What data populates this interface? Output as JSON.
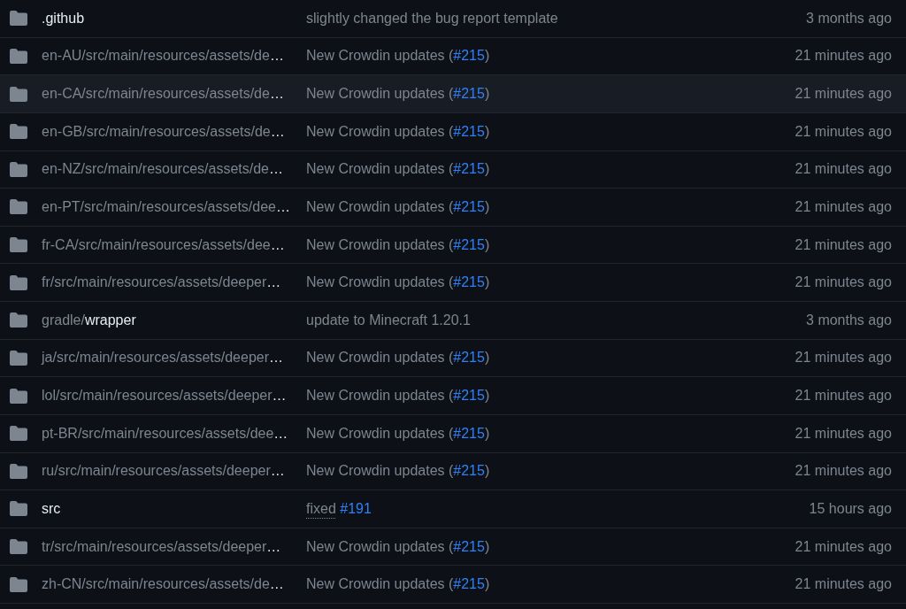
{
  "files": [
    {
      "name": {
        "bright_part": ".github"
      },
      "message": [
        {
          "kind": "text",
          "text": "slightly changed the bug report template"
        }
      ],
      "updated": "3 months ago",
      "highlighted": false
    },
    {
      "name": {
        "dim_part": "en-AU/src/main/resources/assets/de",
        "bright_part": "…"
      },
      "message": [
        {
          "kind": "text",
          "text": "New Crowdin updates ("
        },
        {
          "kind": "issue",
          "text": "#215"
        },
        {
          "kind": "text",
          "text": ")"
        }
      ],
      "updated": "21 minutes ago",
      "highlighted": false
    },
    {
      "name": {
        "dim_part": "en-CA/src/main/resources/assets/de",
        "bright_part": "…"
      },
      "message": [
        {
          "kind": "text",
          "text": "New Crowdin updates ("
        },
        {
          "kind": "issue",
          "text": "#215"
        },
        {
          "kind": "text",
          "text": ")"
        }
      ],
      "updated": "21 minutes ago",
      "highlighted": true
    },
    {
      "name": {
        "dim_part": "en-GB/src/main/resources/assets/de",
        "bright_part": "…"
      },
      "message": [
        {
          "kind": "text",
          "text": "New Crowdin updates ("
        },
        {
          "kind": "issue",
          "text": "#215"
        },
        {
          "kind": "text",
          "text": ")"
        }
      ],
      "updated": "21 minutes ago",
      "highlighted": false
    },
    {
      "name": {
        "dim_part": "en-NZ/src/main/resources/assets/de",
        "bright_part": "…"
      },
      "message": [
        {
          "kind": "text",
          "text": "New Crowdin updates ("
        },
        {
          "kind": "issue",
          "text": "#215"
        },
        {
          "kind": "text",
          "text": ")"
        }
      ],
      "updated": "21 minutes ago",
      "highlighted": false
    },
    {
      "name": {
        "dim_part": "en-PT/src/main/resources/assets/dee",
        "bright_part": "…"
      },
      "message": [
        {
          "kind": "text",
          "text": "New Crowdin updates ("
        },
        {
          "kind": "issue",
          "text": "#215"
        },
        {
          "kind": "text",
          "text": ")"
        }
      ],
      "updated": "21 minutes ago",
      "highlighted": false
    },
    {
      "name": {
        "dim_part": "fr-CA/src/main/resources/assets/dee",
        "bright_part": "…"
      },
      "message": [
        {
          "kind": "text",
          "text": "New Crowdin updates ("
        },
        {
          "kind": "issue",
          "text": "#215"
        },
        {
          "kind": "text",
          "text": ")"
        }
      ],
      "updated": "21 minutes ago",
      "highlighted": false
    },
    {
      "name": {
        "dim_part": "fr/src/main/resources/assets/deeper",
        "bright_part": "…"
      },
      "message": [
        {
          "kind": "text",
          "text": "New Crowdin updates ("
        },
        {
          "kind": "issue",
          "text": "#215"
        },
        {
          "kind": "text",
          "text": ")"
        }
      ],
      "updated": "21 minutes ago",
      "highlighted": false
    },
    {
      "name": {
        "dim_part": "gradle/",
        "bright_part": "wrapper"
      },
      "message": [
        {
          "kind": "text",
          "text": "update to Minecraft 1.20.1"
        }
      ],
      "updated": "3 months ago",
      "highlighted": false
    },
    {
      "name": {
        "dim_part": "ja/src/main/resources/assets/deeper",
        "bright_part": "…"
      },
      "message": [
        {
          "kind": "text",
          "text": "New Crowdin updates ("
        },
        {
          "kind": "issue",
          "text": "#215"
        },
        {
          "kind": "text",
          "text": ")"
        }
      ],
      "updated": "21 minutes ago",
      "highlighted": false
    },
    {
      "name": {
        "dim_part": "lol/src/main/resources/assets/deeper",
        "bright_part": "…"
      },
      "message": [
        {
          "kind": "text",
          "text": "New Crowdin updates ("
        },
        {
          "kind": "issue",
          "text": "#215"
        },
        {
          "kind": "text",
          "text": ")"
        }
      ],
      "updated": "21 minutes ago",
      "highlighted": false
    },
    {
      "name": {
        "dim_part": "pt-BR/src/main/resources/assets/dee",
        "bright_part": "…"
      },
      "message": [
        {
          "kind": "text",
          "text": "New Crowdin updates ("
        },
        {
          "kind": "issue",
          "text": "#215"
        },
        {
          "kind": "text",
          "text": ")"
        }
      ],
      "updated": "21 minutes ago",
      "highlighted": false
    },
    {
      "name": {
        "dim_part": "ru/src/main/resources/assets/deeper",
        "bright_part": "…"
      },
      "message": [
        {
          "kind": "text",
          "text": "New Crowdin updates ("
        },
        {
          "kind": "issue",
          "text": "#215"
        },
        {
          "kind": "text",
          "text": ")"
        }
      ],
      "updated": "21 minutes ago",
      "highlighted": false
    },
    {
      "name": {
        "bright_part": "src"
      },
      "message": [
        {
          "kind": "dotted",
          "text": "fixed "
        },
        {
          "kind": "issue",
          "text": "#191"
        }
      ],
      "updated": "15 hours ago",
      "highlighted": false
    },
    {
      "name": {
        "dim_part": "tr/src/main/resources/assets/deeper",
        "bright_part": "…"
      },
      "message": [
        {
          "kind": "text",
          "text": "New Crowdin updates ("
        },
        {
          "kind": "issue",
          "text": "#215"
        },
        {
          "kind": "text",
          "text": ")"
        }
      ],
      "updated": "21 minutes ago",
      "highlighted": false
    },
    {
      "name": {
        "dim_part": "zh-CN/src/main/resources/assets/de",
        "bright_part": "…"
      },
      "message": [
        {
          "kind": "text",
          "text": "New Crowdin updates ("
        },
        {
          "kind": "issue",
          "text": "#215"
        },
        {
          "kind": "text",
          "text": ")"
        }
      ],
      "updated": "21 minutes ago",
      "highlighted": false
    }
  ]
}
